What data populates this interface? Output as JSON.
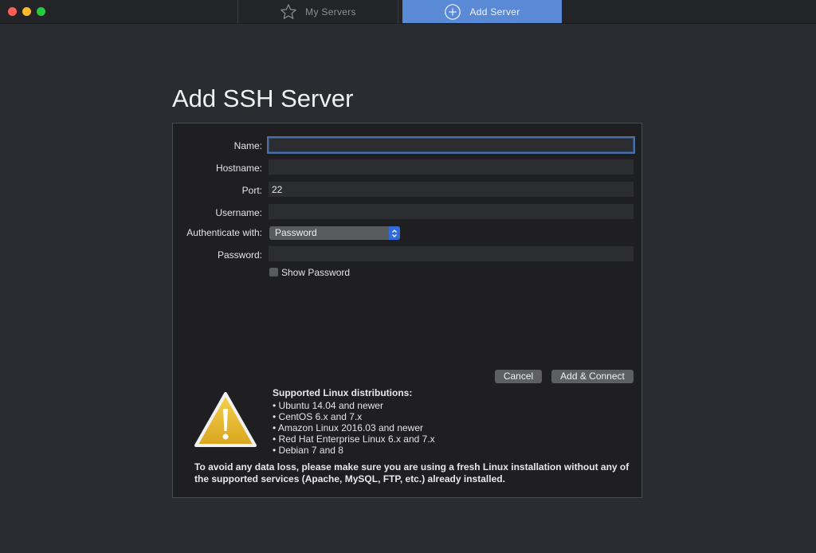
{
  "tabs": {
    "my_servers": "My Servers",
    "add_server": "Add Server"
  },
  "page_title": "Add SSH Server",
  "form": {
    "name_label": "Name:",
    "name_value": "",
    "hostname_label": "Hostname:",
    "hostname_value": "",
    "port_label": "Port:",
    "port_value": "22",
    "username_label": "Username:",
    "username_value": "",
    "auth_label": "Authenticate with:",
    "auth_selected": "Password",
    "password_label": "Password:",
    "password_value": "",
    "show_password_label": "Show Password",
    "show_password_checked": false
  },
  "buttons": {
    "cancel": "Cancel",
    "add_connect": "Add & Connect"
  },
  "info": {
    "title": "Supported Linux distributions:",
    "distributions": [
      "Ubuntu 14.04 and newer",
      "CentOS 6.x and 7.x",
      "Amazon Linux 2016.03 and newer",
      "Red Hat Enterprise Linux 6.x and 7.x",
      "Debian 7 and 8"
    ],
    "notice": "To avoid any data loss, please make sure you are using a fresh Linux installation without any of the supported services (Apache, MySQL, FTP, etc.) already installed."
  },
  "colors": {
    "accent": "#5a8ad6",
    "select_arrow": "#2f6bd9",
    "warning": "#f0c030"
  },
  "icons": {
    "my_servers": "star-icon",
    "add_server": "plus-circle-icon",
    "select": "chevron-updown-icon",
    "warning": "warning-icon"
  }
}
